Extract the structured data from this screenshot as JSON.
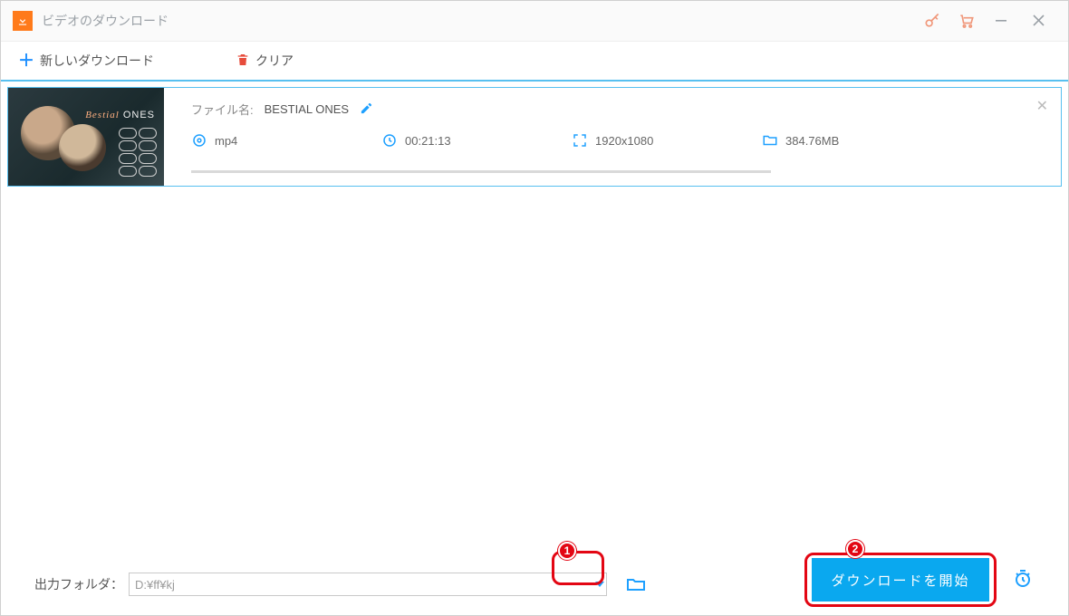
{
  "window": {
    "title": "ビデオのダウンロード"
  },
  "toolbar": {
    "new_download": "新しいダウンロード",
    "clear": "クリア"
  },
  "item": {
    "filename_label": "ファイル名:",
    "filename": "BESTIAL ONES",
    "thumb_caption_prefix": "Bestial",
    "thumb_caption_suffix": " ONES",
    "format": "mp4",
    "duration": "00:21:13",
    "resolution": "1920x1080",
    "size": "384.76MB"
  },
  "output": {
    "label": "出力フォルダ：",
    "path": "D:¥ff¥kj"
  },
  "actions": {
    "start_download": "ダウンロードを開始"
  },
  "callouts": {
    "step1": "1",
    "step2": "2"
  }
}
